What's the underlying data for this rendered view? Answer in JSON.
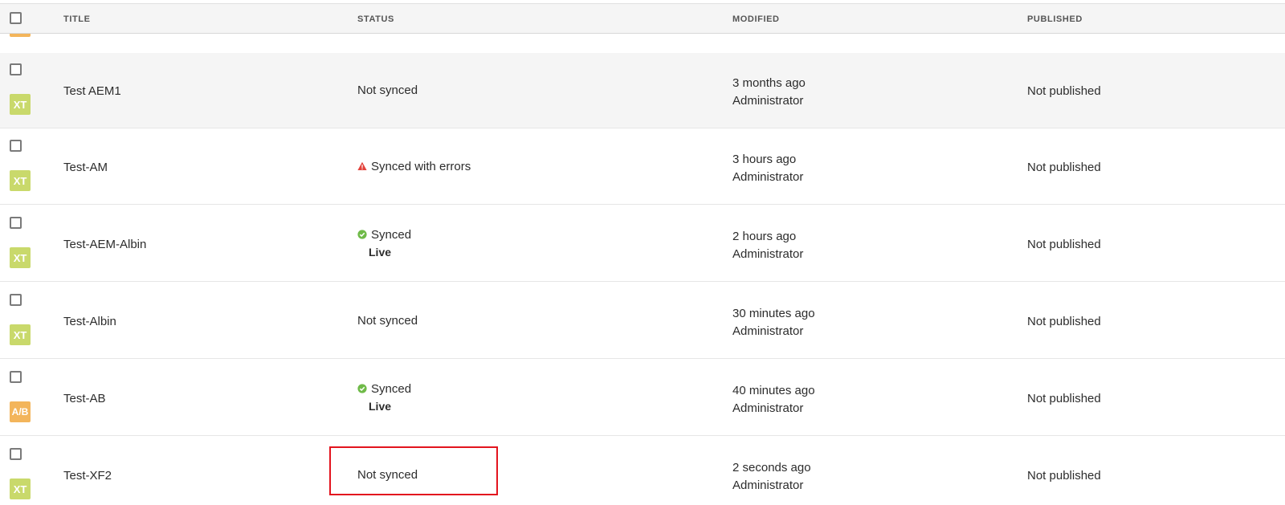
{
  "header": {
    "title": "TITLE",
    "status": "STATUS",
    "modified": "MODIFIED",
    "published": "PUBLISHED"
  },
  "colors": {
    "badge_xt": "#c9d96b",
    "badge_ab": "#f3b55b",
    "synced_ok": "#6fba48",
    "error": "#e3433c",
    "highlight": "#e3141e"
  },
  "rows": [
    {
      "title": "Test AEM1",
      "badge": "XT",
      "status": "Not synced",
      "status_icon": "",
      "live": "",
      "modified_time": "3 months ago",
      "modified_by": "Administrator",
      "published": "Not published"
    },
    {
      "title": "Test-AM",
      "badge": "XT",
      "status": "Synced with errors",
      "status_icon": "alert-triangle-icon",
      "live": "",
      "modified_time": "3 hours ago",
      "modified_by": "Administrator",
      "published": "Not published"
    },
    {
      "title": "Test-AEM-Albin",
      "badge": "XT",
      "status": "Synced",
      "status_icon": "check-circle-icon",
      "live": "Live",
      "modified_time": "2 hours ago",
      "modified_by": "Administrator",
      "published": "Not published"
    },
    {
      "title": "Test-Albin",
      "badge": "XT",
      "status": "Not synced",
      "status_icon": "",
      "live": "",
      "modified_time": "30 minutes ago",
      "modified_by": "Administrator",
      "published": "Not published"
    },
    {
      "title": "Test-AB",
      "badge": "A/B",
      "status": "Synced",
      "status_icon": "check-circle-icon",
      "live": "Live",
      "modified_time": "40 minutes ago",
      "modified_by": "Administrator",
      "published": "Not published"
    },
    {
      "title": "Test-XF2",
      "badge": "XT",
      "status": "Not synced",
      "status_icon": "",
      "live": "",
      "modified_time": "2 seconds ago",
      "modified_by": "Administrator",
      "published": "Not published"
    }
  ]
}
